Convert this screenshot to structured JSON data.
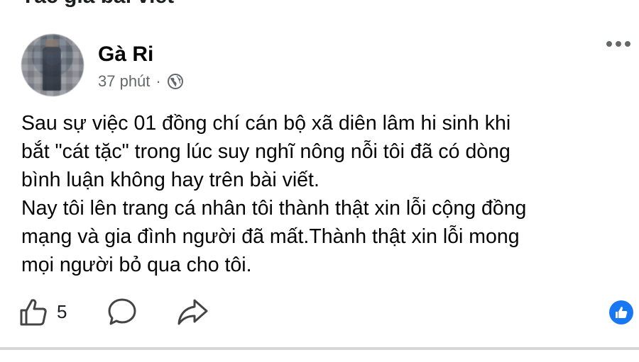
{
  "page": {
    "truncated_heading": "Tác giả bài viết"
  },
  "post": {
    "author_name": "Gà Ri",
    "timestamp": "37 phút",
    "separator": "·",
    "audience_icon": "globe-icon",
    "text": "Sau sự việc 01 đồng chí cán bộ xã diên lâm hi sinh khi\nbắt \"cát tặc\" trong lúc suy nghĩ nông nỗi tôi đã có dòng\nbình luận không hay trên bài viết.\nNay tôi lên trang cá nhân tôi thành thật xin lỗi cộng đồng\nmạng và gia đình người đã mất.Thành thật xin lỗi mong\nmọi người bỏ qua cho tôi.",
    "like_count": "5"
  },
  "icons": {
    "more": "more-options-icon",
    "like": "thumbs-up-icon",
    "comment": "comment-bubble-icon",
    "share": "share-arrow-icon",
    "like_badge": "like-reaction-icon"
  },
  "colors": {
    "accent": "#1877f2",
    "secondary_text": "#65676b"
  }
}
